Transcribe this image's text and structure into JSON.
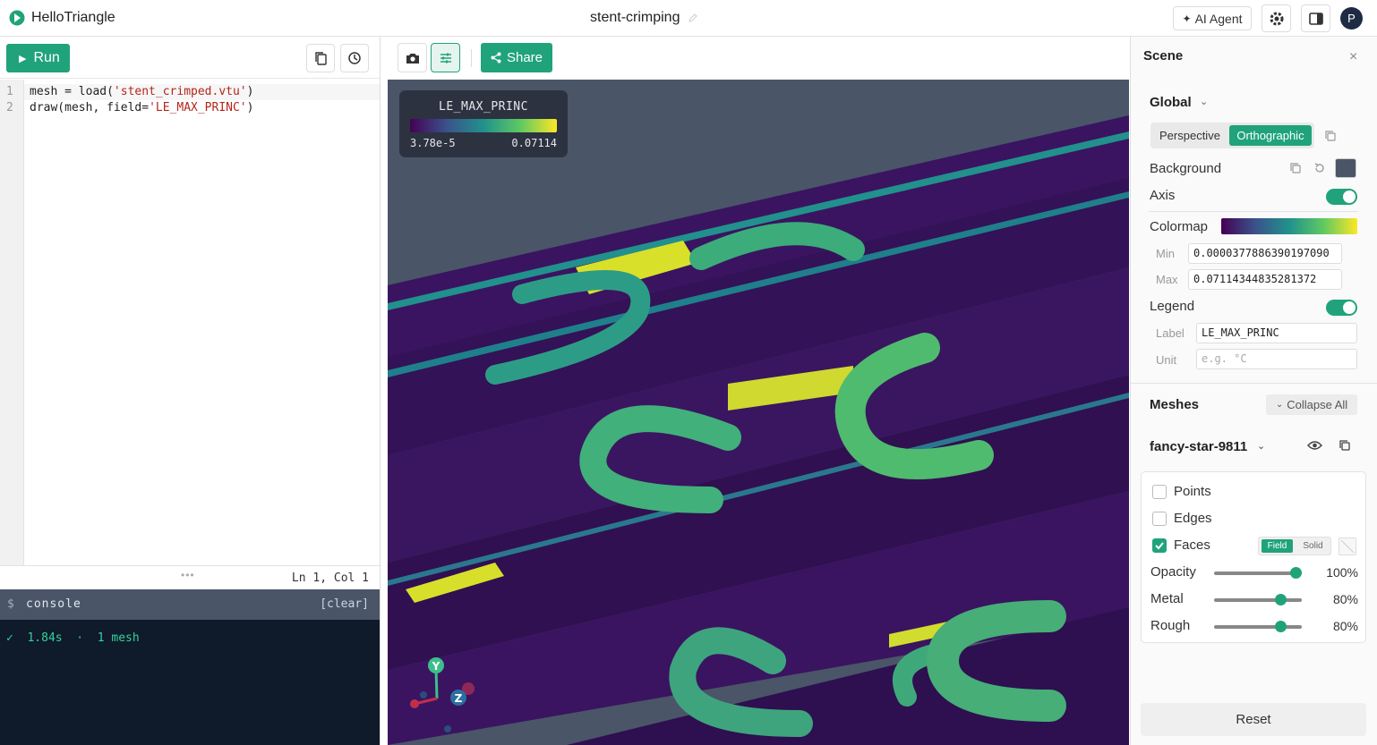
{
  "app": {
    "brand": "HelloTriangle",
    "doc_title": "stent-crimping",
    "ai_agent_label": "AI Agent",
    "avatar_initial": "P"
  },
  "editor": {
    "run_label": "Run",
    "line_numbers": [
      "1",
      "2"
    ],
    "lines": [
      {
        "pre": "mesh = load(",
        "str": "'stent_crimped.vtu'",
        "post": ")"
      },
      {
        "pre": "draw(mesh, field=",
        "str": "'LE_MAX_PRINC'",
        "post": ")"
      }
    ],
    "cursor_position": "Ln 1, Col 1",
    "drag_handle": "•••"
  },
  "console": {
    "prompt": "$",
    "title": "console",
    "clear_label": "[clear]",
    "output": "✓  1.84s  ·  1 mesh"
  },
  "viewport": {
    "share_label": "Share",
    "legend": {
      "label": "LE_MAX_PRINC",
      "min": "3.78e-5",
      "max": "0.07114"
    },
    "axis_labels": {
      "y": "Y",
      "z": "Z"
    }
  },
  "panel": {
    "title": "Scene",
    "close": "×",
    "global": {
      "title": "Global",
      "perspective": "Perspective",
      "orthographic": "Orthographic",
      "selected_projection": "Orthographic",
      "background_label": "Background",
      "background_color": "#4a5568",
      "axis_label": "Axis",
      "axis_on": true,
      "colormap_label": "Colormap",
      "min_label": "Min",
      "min_value": "0.0000377886390197090",
      "max_label": "Max",
      "max_value": "0.07114344835281372",
      "legend_label": "Legend",
      "legend_on": true,
      "legend_label_label": "Label",
      "legend_label_value": "LE_MAX_PRINC",
      "unit_label": "Unit",
      "unit_placeholder": "e.g. °C"
    },
    "meshes": {
      "title": "Meshes",
      "collapse_all": "Collapse All",
      "mesh_name": "fancy-star-9811",
      "points_label": "Points",
      "points_on": false,
      "edges_label": "Edges",
      "edges_on": false,
      "faces_label": "Faces",
      "faces_on": true,
      "field_label": "Field",
      "solid_label": "Solid",
      "opacity_label": "Opacity",
      "opacity_value": "100%",
      "opacity": 1.0,
      "metal_label": "Metal",
      "metal_value": "80%",
      "metal": 0.8,
      "rough_label": "Rough",
      "rough_value": "80%",
      "rough": 0.8
    },
    "reset_label": "Reset"
  },
  "colors": {
    "accent": "#20a37a",
    "viewport_bg": "#4a5568",
    "console_bg": "#0f1a2b"
  }
}
